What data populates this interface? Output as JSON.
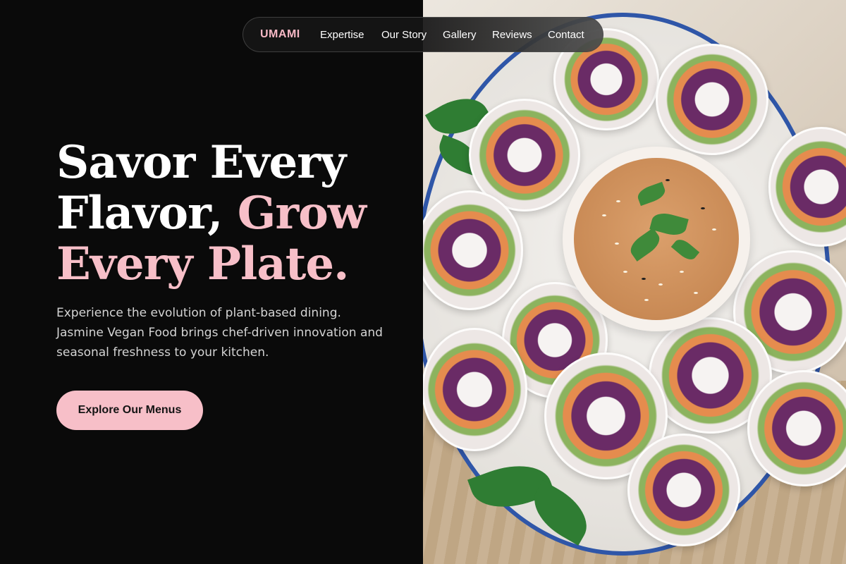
{
  "nav": {
    "brand": "UMAMI",
    "links": [
      {
        "label": "Expertise"
      },
      {
        "label": "Our Story"
      },
      {
        "label": "Gallery"
      },
      {
        "label": "Reviews"
      },
      {
        "label": "Contact"
      }
    ]
  },
  "hero": {
    "title_line1": "Savor Every",
    "title_line2_white": "Flavor, ",
    "title_line2_pink": "Grow",
    "title_line3_pink": "Every Plate.",
    "description": "Experience the evolution of plant-based dining. Jasmine Vegan Food brings chef-driven innovation and seasonal freshness to your kitchen.",
    "cta_label": "Explore Our Menus"
  },
  "image": {
    "subject": "spring-rolls-with-peanut-dipping-sauce"
  },
  "colors": {
    "accent_pink": "#f7bfc8",
    "background": "#0a0a0a",
    "text_white": "#ffffff",
    "text_muted": "#d4d4d4"
  }
}
